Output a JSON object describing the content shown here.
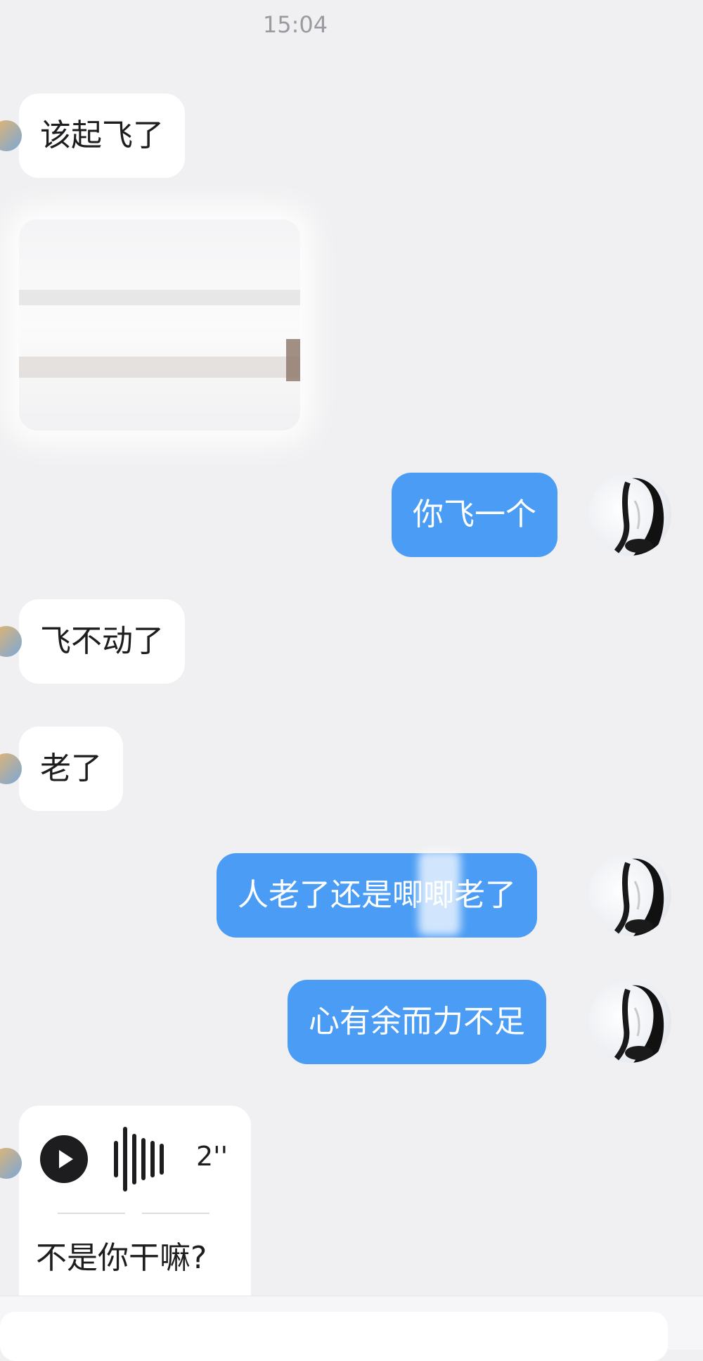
{
  "header": {
    "time": "15:04"
  },
  "messages": [
    {
      "text": "该起飞了"
    },
    {
      "text": "你飞一个"
    },
    {
      "text": "飞不动了"
    },
    {
      "text": "老了"
    },
    {
      "text": "人老了还是唧唧老了"
    },
    {
      "text": "心有余而力不足"
    }
  ],
  "voice_message": {
    "duration": "2''",
    "transcript": "不是你干嘛?"
  },
  "colors": {
    "outgoing_bubble": "#4a9cf5",
    "incoming_bubble": "#ffffff",
    "background": "#f0f0f2"
  },
  "icons": {
    "play": "play-icon",
    "waveform": "waveform-icon"
  }
}
